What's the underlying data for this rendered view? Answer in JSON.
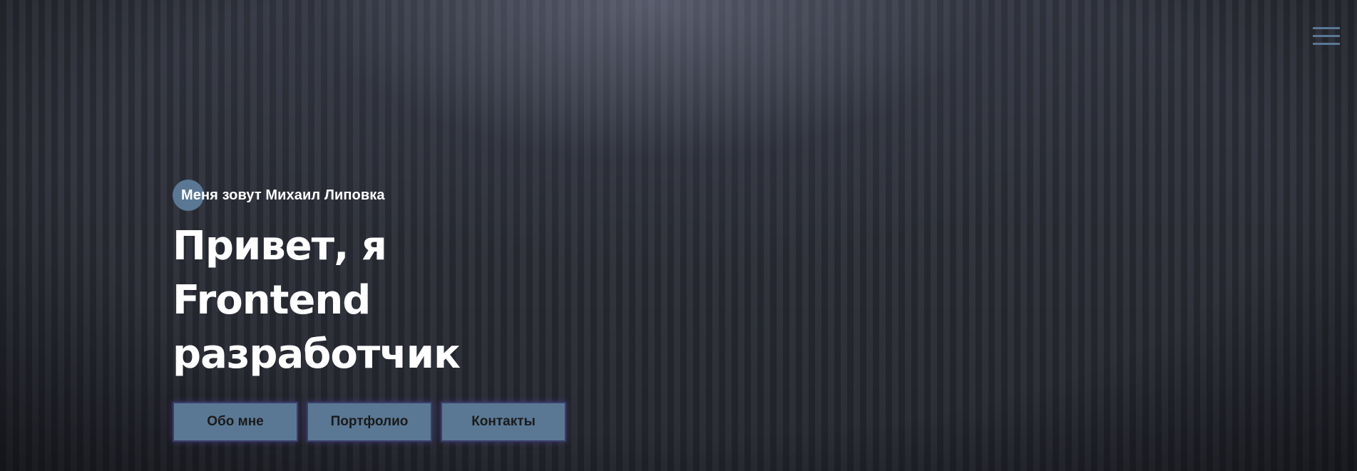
{
  "header": {
    "menu_icon": "hamburger-menu-icon"
  },
  "hero": {
    "intro": "Меня зовут Михаил Липовка",
    "headline_line1": "Привет, я Frontend",
    "headline_line2": "разработчик",
    "buttons": [
      {
        "label": "Обо мне"
      },
      {
        "label": "Портфолио"
      },
      {
        "label": "Контакты"
      }
    ]
  },
  "colors": {
    "accent": "#5a7894",
    "background": "#2a2d36",
    "text": "#ffffff"
  }
}
